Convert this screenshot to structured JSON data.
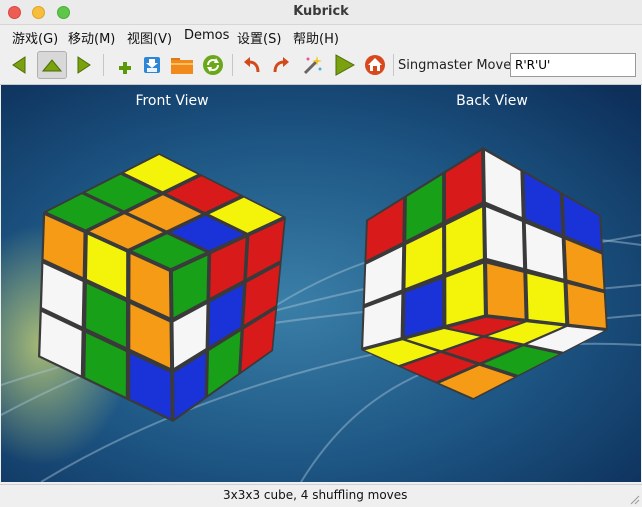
{
  "window": {
    "title": "Kubrick"
  },
  "menu": [
    "游戏(G)",
    "移动(M)",
    "视图(V)",
    "Demos",
    "设置(S)",
    "帮助(H)"
  ],
  "toolbar": {
    "buttons": [
      "arrow-left-icon",
      "arrow-up-icon",
      "arrow-right-icon",
      "new-puzzle-icon",
      "save-icon",
      "open-folder-icon",
      "restart-icon",
      "undo-icon",
      "redo-icon",
      "solve-wand-icon",
      "play-icon",
      "home-icon"
    ],
    "moves_label": "Singmaster Moves",
    "moves_value": "R'R'U'"
  },
  "view": {
    "front_label": "Front View",
    "back_label": "Back View"
  },
  "status": {
    "text": "3x3x3 cube, 4 shuffling moves"
  },
  "colors": {
    "red": "#d91a1a",
    "green": "#19a019",
    "blue": "#1a33d9",
    "yellow": "#f4f40a",
    "orange": "#f59b16",
    "white": "#f6f6f6"
  }
}
